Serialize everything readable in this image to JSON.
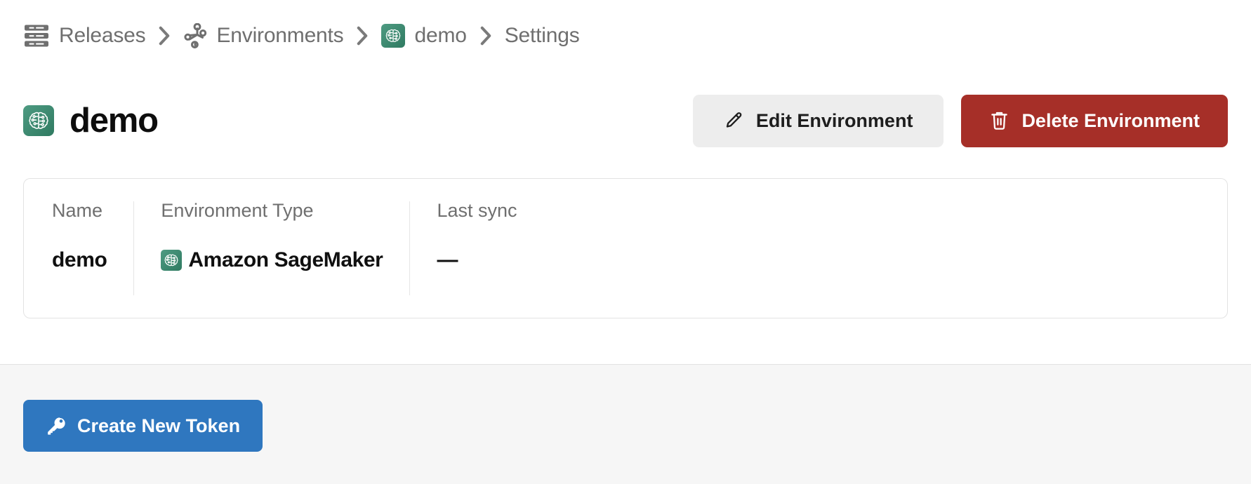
{
  "breadcrumb": {
    "items": [
      {
        "label": "Releases",
        "icon": "releases-stack-icon"
      },
      {
        "label": "Environments",
        "icon": "network-graph-icon"
      },
      {
        "label": "demo",
        "icon": "sagemaker-brain-icon"
      },
      {
        "label": "Settings",
        "icon": ""
      }
    ],
    "separator": "›"
  },
  "header": {
    "title": "demo",
    "icon": "sagemaker-brain-icon",
    "edit_button": {
      "label": "Edit Environment",
      "icon": "pencil-icon",
      "bg": "#ededed",
      "fg": "#1e1e1e"
    },
    "delete_button": {
      "label": "Delete Environment",
      "icon": "trash-icon",
      "bg": "#a62f28",
      "fg": "#ffffff"
    }
  },
  "info_card": {
    "columns": [
      {
        "label": "Name",
        "value": "demo",
        "icon": ""
      },
      {
        "label": "Environment Type",
        "value": "Amazon SageMaker",
        "icon": "sagemaker-brain-icon"
      },
      {
        "label": "Last sync",
        "value": "—",
        "icon": ""
      }
    ]
  },
  "footer": {
    "create_token_button": {
      "label": "Create New Token",
      "icon": "key-icon",
      "bg": "#2f77bf",
      "fg": "#ffffff"
    }
  },
  "colors": {
    "sagemaker_green_light": "#4e9b82",
    "sagemaker_green_dark": "#2f7a61",
    "danger_red": "#a62f28",
    "primary_blue": "#2f77bf",
    "neutral_gray": "#ededed",
    "text_muted": "#6f6f6f",
    "panel_bg": "#f6f6f6",
    "border": "#e3e3e3"
  }
}
